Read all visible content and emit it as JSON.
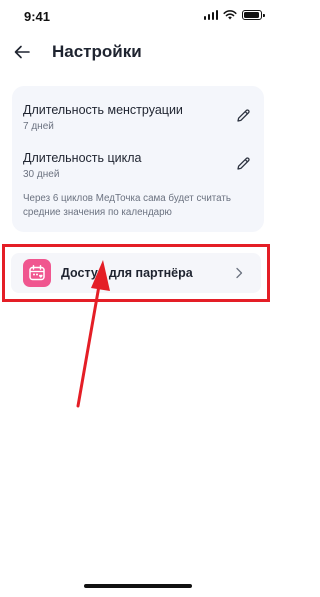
{
  "status_bar": {
    "time": "9:41"
  },
  "header": {
    "title": "Настройки",
    "back_icon": "arrow-left-icon"
  },
  "settings": {
    "menstruation": {
      "label": "Длительность менструации",
      "value": "7 дней"
    },
    "cycle": {
      "label": "Длительность цикла",
      "value": "30 дней"
    },
    "hint": "Через 6 циклов МедТочка сама будет считать средние значения по календарю"
  },
  "partner": {
    "label": "Доступ для партнёра",
    "icon": "calendar-heart-icon"
  },
  "colors": {
    "accent_pink": "#f0568f",
    "highlight_red": "#e41e26",
    "card_bg": "#f4f6fb"
  }
}
